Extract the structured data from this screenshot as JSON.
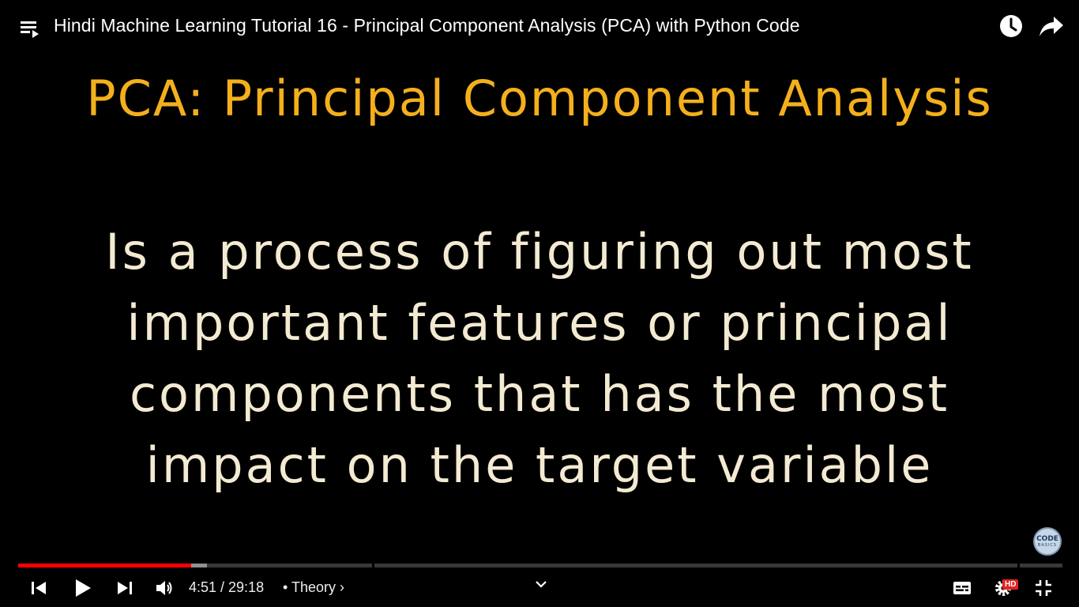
{
  "header": {
    "title": "Hindi Machine Learning Tutorial 16 - Principal Component Analysis (PCA) with Python Code",
    "playlist_icon": "playlist-icon",
    "watch_later_icon": "clock-icon",
    "share_icon": "share-arrow-icon"
  },
  "slide": {
    "heading": "PCA: Principal Component Analysis",
    "lines": [
      "Is a process of figuring out most",
      "important features or principal",
      "components that has the most",
      "impact on the target variable"
    ],
    "heading_color": "#f4b01c",
    "text_color": "#f3ead2"
  },
  "watermark": {
    "line1": "CODE",
    "line2": "BASICS"
  },
  "player": {
    "current_time": "4:51",
    "duration": "29:18",
    "time_display": "4:51 / 29:18",
    "chapter": "• Theory",
    "played_fraction": 0.1657,
    "quality_badge": "HD",
    "progress_color": "#ff0000"
  }
}
